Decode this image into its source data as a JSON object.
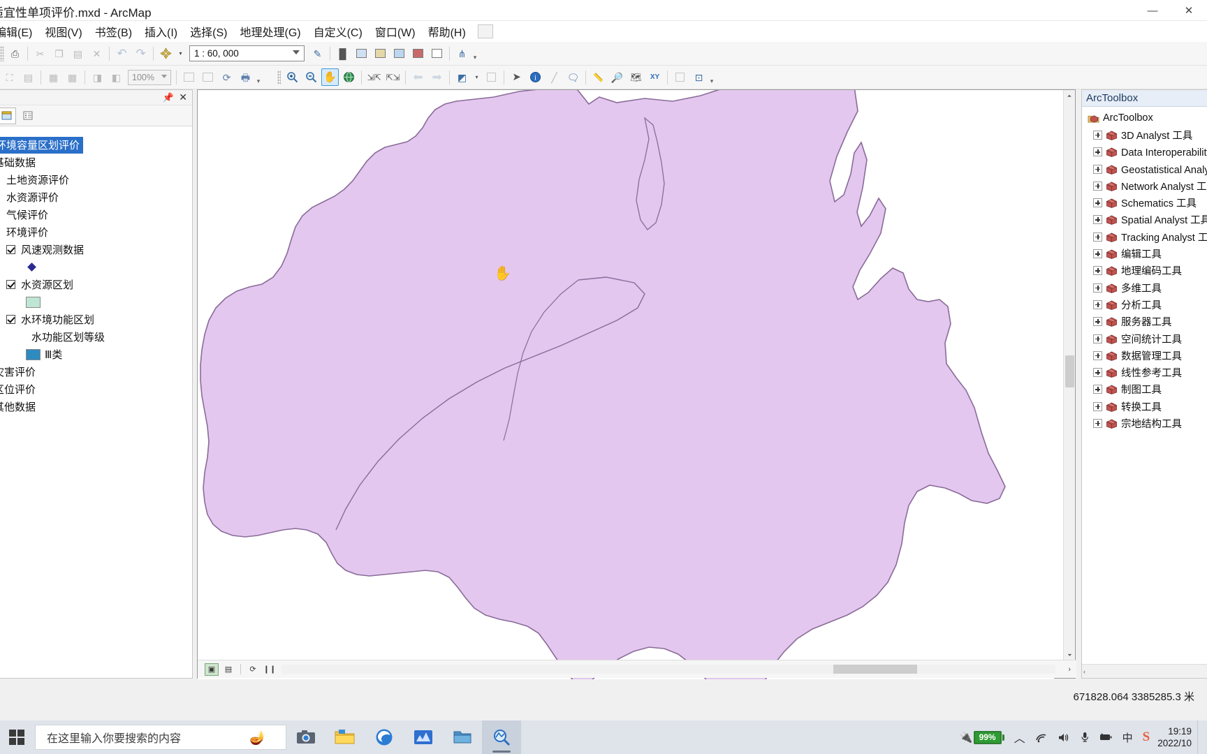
{
  "window": {
    "title": "适宜性单项评价.mxd - ArcMap",
    "minimize_label": "—",
    "maximize_label": "❐",
    "close_label": "✕"
  },
  "menubar": {
    "items": [
      {
        "label": "编辑(E)",
        "name": "menu-edit"
      },
      {
        "label": "视图(V)",
        "name": "menu-view"
      },
      {
        "label": "书签(B)",
        "name": "menu-bookmarks"
      },
      {
        "label": "插入(I)",
        "name": "menu-insert"
      },
      {
        "label": "选择(S)",
        "name": "menu-selection"
      },
      {
        "label": "地理处理(G)",
        "name": "menu-geoprocessing"
      },
      {
        "label": "自定义(C)",
        "name": "menu-customize"
      },
      {
        "label": "窗口(W)",
        "name": "menu-window"
      },
      {
        "label": "帮助(H)",
        "name": "menu-help"
      }
    ]
  },
  "toolbar_standard": {
    "scale_value": "1 : 60, 000",
    "buttons": [
      {
        "icon": "print-icon",
        "glyph": "⎙",
        "disabled": false
      },
      {
        "icon": "cut-icon",
        "glyph": "✂",
        "disabled": true
      },
      {
        "icon": "copy-icon",
        "glyph": "⧉",
        "disabled": true
      },
      {
        "icon": "paste-icon",
        "glyph": "📋",
        "disabled": true
      },
      {
        "icon": "delete-icon",
        "glyph": "✕",
        "disabled": true
      },
      {
        "icon": "undo-icon",
        "glyph": "↶",
        "disabled": true
      },
      {
        "icon": "redo-icon",
        "glyph": "↷",
        "disabled": true
      },
      {
        "icon": "add-data-icon",
        "glyph": "✛",
        "disabled": false
      },
      {
        "icon": "editor-toolbar-icon",
        "glyph": "✎",
        "disabled": false
      },
      {
        "icon": "table-of-contents-icon",
        "glyph": "▐",
        "disabled": false
      },
      {
        "icon": "catalog-window-icon",
        "glyph": "▤",
        "disabled": false
      },
      {
        "icon": "search-window-icon",
        "glyph": "▦",
        "disabled": false
      },
      {
        "icon": "arctoolbox-icon",
        "glyph": "▩",
        "disabled": false
      },
      {
        "icon": "python-window-icon",
        "glyph": "▣",
        "disabled": false
      },
      {
        "icon": "modelbuilder-icon",
        "glyph": "▭",
        "disabled": false
      },
      {
        "icon": "model-window-icon",
        "glyph": "⋔",
        "disabled": false
      }
    ]
  },
  "toolbar_draw": {
    "zoom_percent": "100%",
    "buttons": [
      {
        "icon": "full-extent-icon",
        "glyph": "⛶",
        "disabled": true
      },
      {
        "icon": "page-icon",
        "glyph": "▤",
        "disabled": true
      },
      {
        "icon": "zoom-in-page-icon",
        "glyph": "⊞",
        "disabled": true
      },
      {
        "icon": "zoom-out-page-icon",
        "glyph": "⊟",
        "disabled": true
      },
      {
        "icon": "previous-page-icon",
        "glyph": "◫",
        "disabled": true
      },
      {
        "icon": "next-page-icon",
        "glyph": "◧",
        "disabled": true
      }
    ],
    "layout_buttons": [
      {
        "icon": "layout-view-icon",
        "glyph": "▭",
        "disabled": true
      },
      {
        "icon": "data-driven-pages-icon",
        "glyph": "▥",
        "disabled": true
      },
      {
        "icon": "refresh-view-icon",
        "glyph": "⟳",
        "disabled": false
      },
      {
        "icon": "print-preview-icon",
        "glyph": "🖶",
        "disabled": false
      }
    ]
  },
  "toolbar_tools": {
    "buttons": [
      {
        "icon": "zoom-in-icon",
        "glyph": "⊕",
        "active": false
      },
      {
        "icon": "zoom-out-icon",
        "glyph": "⊖",
        "active": false
      },
      {
        "icon": "pan-icon",
        "glyph": "✋",
        "active": true
      },
      {
        "icon": "full-extent-globe-icon",
        "glyph": "🌐",
        "active": false
      },
      {
        "icon": "fixed-zoom-in-icon",
        "glyph": "⤡",
        "active": false
      },
      {
        "icon": "fixed-zoom-out-icon",
        "glyph": "⤢",
        "active": false
      },
      {
        "icon": "go-back-extent-icon",
        "glyph": "⬅",
        "active": false
      },
      {
        "icon": "go-forward-extent-icon",
        "glyph": "➡",
        "active": false
      },
      {
        "icon": "select-features-icon",
        "glyph": "◩",
        "active": false
      },
      {
        "icon": "clear-selection-icon",
        "glyph": "▢",
        "active": false
      },
      {
        "icon": "select-elements-icon",
        "glyph": "➤",
        "active": false
      },
      {
        "icon": "identify-icon",
        "glyph": "ⓘ",
        "active": false
      },
      {
        "icon": "hyperlink-icon",
        "glyph": "∕",
        "active": false
      },
      {
        "icon": "html-popup-icon",
        "glyph": "🗨",
        "active": false
      },
      {
        "icon": "measure-icon",
        "glyph": "📏",
        "active": false
      },
      {
        "icon": "find-icon",
        "glyph": "🔍",
        "active": false
      },
      {
        "icon": "find-route-icon",
        "glyph": "🗺",
        "active": false
      },
      {
        "icon": "go-to-xy-icon",
        "glyph": "XY",
        "active": false
      },
      {
        "icon": "time-slider-icon",
        "glyph": "◴",
        "active": false
      },
      {
        "icon": "create-viewer-icon",
        "glyph": "⊡",
        "active": false
      }
    ]
  },
  "toc": {
    "panel_title": "",
    "pin_glyph": "📌",
    "close_glyph": "✕",
    "tabs": [
      {
        "name": "list-by-drawing-order-tab",
        "glyph": "▤",
        "selected": true
      },
      {
        "name": "list-by-source-tab",
        "glyph": "▣",
        "selected": false
      }
    ],
    "items": [
      {
        "label": "环境容量区划评价",
        "indent": 0,
        "type": "dataframe",
        "selected": true,
        "checkbox": null
      },
      {
        "label": "基础数据",
        "indent": 0,
        "type": "group",
        "checkbox": null
      },
      {
        "label": "土地资源评价",
        "indent": 1,
        "type": "group",
        "checkbox": null
      },
      {
        "label": "水资源评价",
        "indent": 1,
        "type": "group",
        "checkbox": null
      },
      {
        "label": "气候评价",
        "indent": 1,
        "type": "group",
        "checkbox": null
      },
      {
        "label": "环境评价",
        "indent": 1,
        "type": "group",
        "checkbox": null
      },
      {
        "label": "风速观测数据",
        "indent": 1,
        "type": "layer",
        "checkbox": true
      },
      {
        "label": "",
        "indent": 2,
        "type": "symbol-point",
        "symbol_color": "#2b2b8f"
      },
      {
        "label": "水资源区划",
        "indent": 1,
        "type": "layer",
        "checkbox": true
      },
      {
        "label": "",
        "indent": 2,
        "type": "symbol-fill",
        "symbol_color": "#bfe6d4"
      },
      {
        "label": "水环境功能区划",
        "indent": 1,
        "type": "layer",
        "checkbox": true
      },
      {
        "label": "水功能区划等级",
        "indent": 3,
        "type": "field"
      },
      {
        "label": "Ⅲ类",
        "indent": 2,
        "type": "symbol-fill-label",
        "symbol_color": "#2e8bc0"
      },
      {
        "label": "灾害评价",
        "indent": 0,
        "type": "group",
        "checkbox": null
      },
      {
        "label": "区位评价",
        "indent": 0,
        "type": "group",
        "checkbox": null
      },
      {
        "label": "其他数据",
        "indent": 0,
        "type": "group",
        "checkbox": null
      }
    ]
  },
  "map": {
    "polygon_fill": "#e3c7ef",
    "polygon_stroke": "#8a6b99",
    "background": "#ffffff",
    "cursor_glyph": "✋",
    "bottom_buttons": [
      {
        "name": "data-view-button",
        "glyph": "▣",
        "selected": true
      },
      {
        "name": "layout-view-button",
        "glyph": "▤",
        "selected": false
      },
      {
        "name": "refresh-button",
        "glyph": "⟳",
        "selected": false
      },
      {
        "name": "pause-drawing-button",
        "glyph": "❙❙",
        "selected": false
      },
      {
        "name": "collapse-button",
        "glyph": "‹",
        "selected": false
      }
    ],
    "scroll_right_glyph": "›",
    "scroll_up_glyph": "⏶",
    "scroll_down_glyph": "⏷"
  },
  "arctoolbox": {
    "title": "ArcToolbox",
    "root_label": "ArcToolbox",
    "items": [
      "3D Analyst 工具",
      "Data Interoperability 工具",
      "Geostatistical Analyst 工具",
      "Network Analyst 工具",
      "Schematics 工具",
      "Spatial Analyst 工具",
      "Tracking Analyst 工具",
      "编辑工具",
      "地理编码工具",
      "多维工具",
      "分析工具",
      "服务器工具",
      "空间统计工具",
      "数据管理工具",
      "线性参考工具",
      "制图工具",
      "转换工具",
      "宗地结构工具"
    ],
    "scroll_left_glyph": "‹",
    "scroll_right_glyph": "›"
  },
  "statusbar": {
    "coordinates": "671828.064  3385285.3 米"
  },
  "taskbar": {
    "search_placeholder": "在这里输入你要搜索的内容",
    "apps": [
      {
        "name": "taskbar-camera",
        "glyph": "📷",
        "active": false
      },
      {
        "name": "taskbar-file-explorer",
        "glyph": "🗂",
        "active": false
      },
      {
        "name": "taskbar-edge",
        "glyph": "e",
        "active": false
      },
      {
        "name": "taskbar-wps",
        "glyph": "📈",
        "active": false
      },
      {
        "name": "taskbar-folder",
        "glyph": "📁",
        "active": false
      },
      {
        "name": "taskbar-arcmap",
        "glyph": "🔍",
        "active": true
      }
    ],
    "tray": {
      "battery_percent": "99%",
      "chevron_glyph": "︿",
      "wifi_glyph": "📶",
      "volume_glyph": "🔊",
      "mic_glyph": "🎤",
      "power_glyph": "🔋",
      "ime_glyph": "中",
      "sogou_glyph": "S"
    },
    "clock": {
      "time": "19:19",
      "date": "2022/10"
    }
  }
}
